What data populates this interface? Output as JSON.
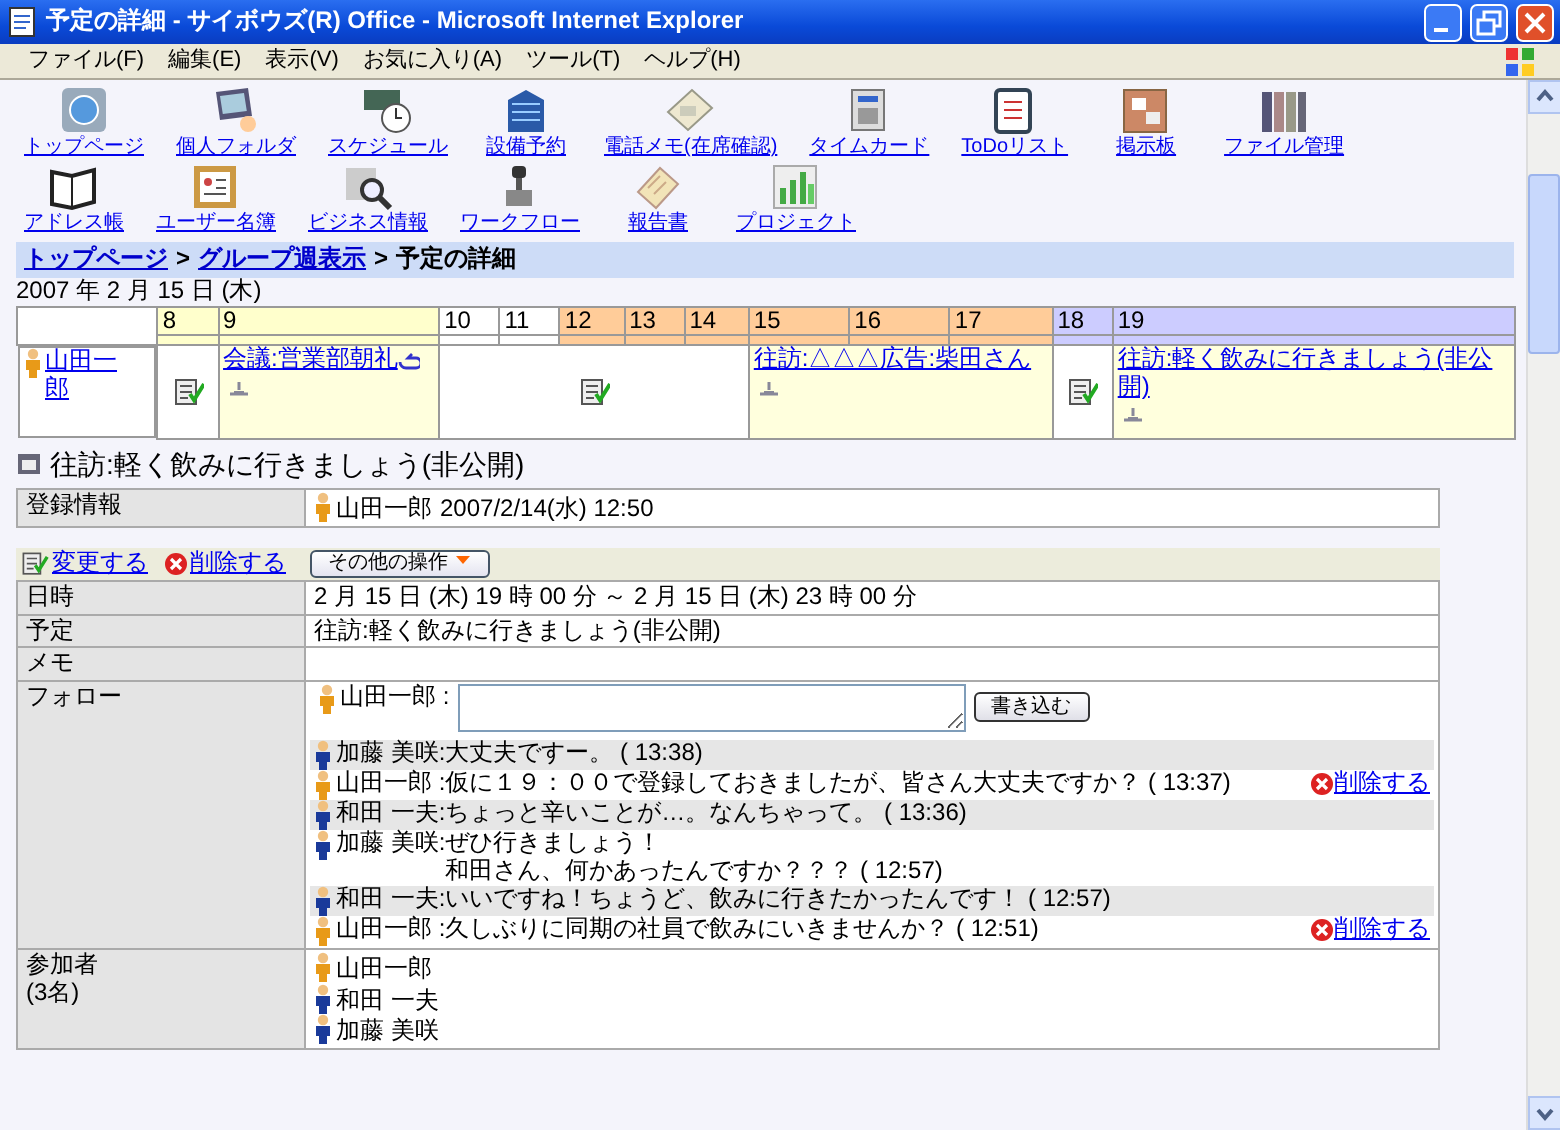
{
  "window": {
    "title": "予定の詳細 - サイボウズ(R) Office - Microsoft Internet Explorer"
  },
  "menu": [
    "ファイル(F)",
    "編集(E)",
    "表示(V)",
    "お気に入り(A)",
    "ツール(T)",
    "ヘルプ(H)"
  ],
  "apps": [
    "トップページ",
    "個人フォルダ",
    "スケジュール",
    "設備予約",
    "電話メモ(在席確認)",
    "タイムカード",
    "ToDoリスト",
    "掲示板",
    "ファイル管理",
    "アドレス帳",
    "ユーザー名簿",
    "ビジネス情報",
    "ワークフロー",
    "報告書",
    "プロジェクト"
  ],
  "breadcrumb": {
    "separator": ">",
    "items": [
      {
        "label": "トップページ",
        "link": true
      },
      {
        "label": "グループ週表示",
        "link": true
      },
      {
        "label": "予定の詳細",
        "link": false
      }
    ]
  },
  "date": "2007 年 2 月 15 日 (木)",
  "timeline": {
    "user": {
      "name": "山田一郎",
      "color": "#e89a18"
    },
    "hours": [
      {
        "label": "8",
        "color": "#ffffcc"
      },
      {
        "label": "9",
        "color": "#ffffcc"
      },
      {
        "label": "10",
        "color": "#ffffff"
      },
      {
        "label": "11",
        "color": "#ffffff"
      },
      {
        "label": "12",
        "color": "#ffcc99"
      },
      {
        "label": "13",
        "color": "#ffcc99"
      },
      {
        "label": "14",
        "color": "#ffcc99"
      },
      {
        "label": "15",
        "color": "#ffcc99"
      },
      {
        "label": "16",
        "color": "#ffcc99"
      },
      {
        "label": "17",
        "color": "#ffcc99"
      },
      {
        "label": "18",
        "color": "#ccccff"
      },
      {
        "label": "19",
        "color": "#ccccff"
      }
    ],
    "slots": [
      {
        "kind": "free"
      },
      {
        "kind": "event",
        "title": "会議:営業部朝礼",
        "repeat": true
      },
      {
        "kind": "free"
      },
      {
        "kind": "event",
        "title": "往訪:△△△広告:柴田さん",
        "repeat": false
      },
      {
        "kind": "free"
      },
      {
        "kind": "event",
        "title": "往訪:軽く飲みに行きましょう(非公開)",
        "repeat": false
      }
    ]
  },
  "event_title": "往訪:軽く飲みに行きましょう(非公開)",
  "registration": {
    "label": "登録情報",
    "user": {
      "name": "山田一郎",
      "color": "#e89a18"
    },
    "info": "2007/2/14(水) 12:50"
  },
  "actions": {
    "edit": "変更する",
    "delete": "削除する",
    "more": "その他の操作"
  },
  "details": [
    {
      "label": "日時",
      "value": "2 月 15 日 (木) 19 時 00 分 ～ 2 月 15 日 (木) 23 時 00 分"
    },
    {
      "label": "予定",
      "value": "往訪:軽く飲みに行きましょう(非公開)"
    },
    {
      "label": "メモ"
    }
  ],
  "follow": {
    "label": "フォロー",
    "author": {
      "name": "山田一郎 :",
      "color": "#e89a18"
    },
    "submit": "書き込む",
    "comments": [
      {
        "name": "加藤 美咲:",
        "color": "#1a3a9a",
        "lines": [
          "大丈夫ですー。"
        ],
        "time": "( 13:38)"
      },
      {
        "name": "山田一郎 :",
        "color": "#e89a18",
        "lines": [
          "仮に１９：００で登録しておきましたが、皆さん大丈夫ですか？"
        ],
        "time": "( 13:37)",
        "delete": "削除する"
      },
      {
        "name": "和田 一夫:",
        "color": "#1a3a9a",
        "lines": [
          "ちょっと辛いことが…。なんちゃって。"
        ],
        "time": "( 13:36)"
      },
      {
        "name": "加藤 美咲:",
        "color": "#1a3a9a",
        "lines": [
          "ぜひ行きましょう！",
          "和田さん、何かあったんですか？？？"
        ],
        "time": "( 12:57)"
      },
      {
        "name": "和田 一夫:",
        "color": "#1a3a9a",
        "lines": [
          "いいですね！ちょうど、飲みに行きたかったんです！"
        ],
        "time": "( 12:57)"
      },
      {
        "name": "山田一郎 :",
        "color": "#e89a18",
        "lines": [
          "久しぶりに同期の社員で飲みにいきませんか？"
        ],
        "time": "( 12:51)",
        "delete": "削除する"
      }
    ]
  },
  "participants": {
    "label": "参加者",
    "count": "(3名)",
    "people": [
      {
        "name": "山田一郎",
        "color": "#e89a18"
      },
      {
        "name": "和田 一夫",
        "color": "#1a3a9a"
      },
      {
        "name": "加藤 美咲",
        "color": "#1a3a9a"
      }
    ]
  }
}
